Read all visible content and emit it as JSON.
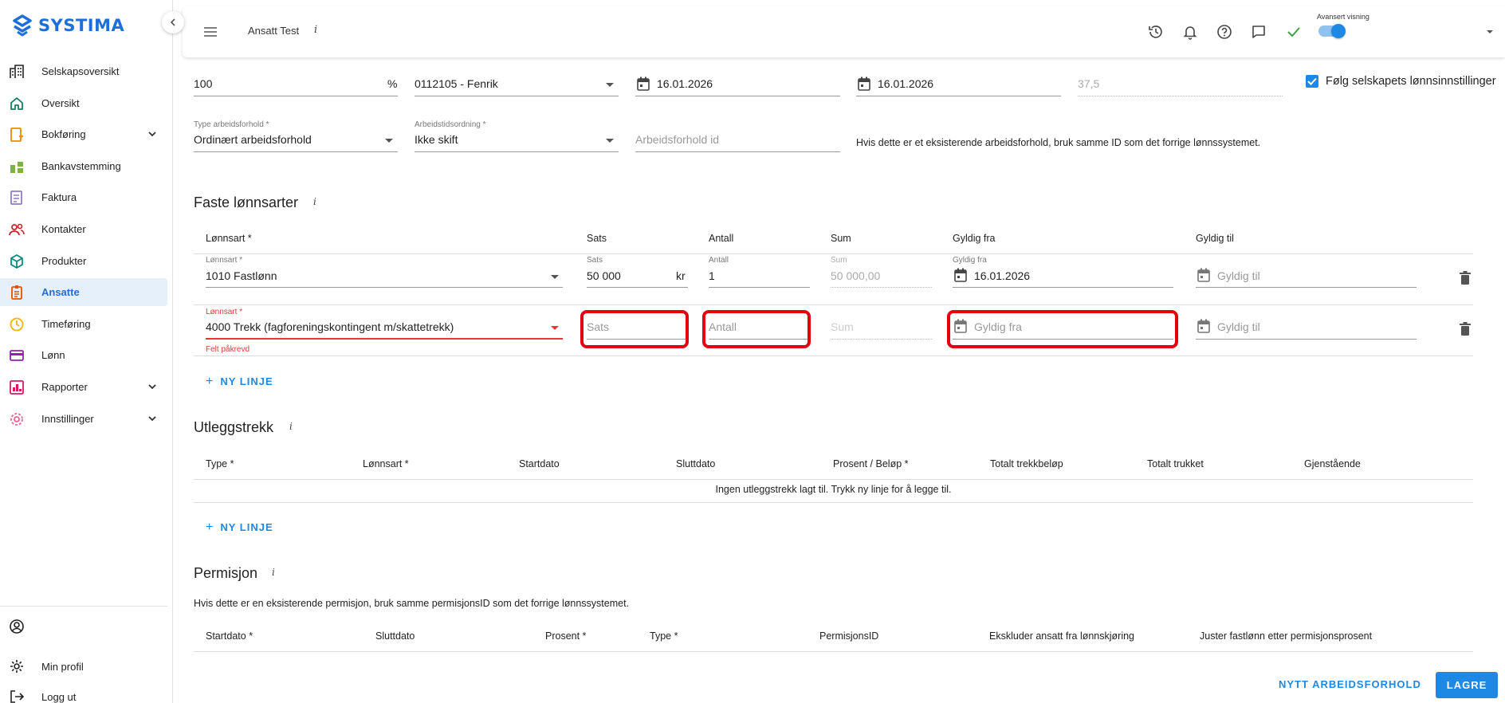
{
  "brand": {
    "name": "SYSTIMA",
    "color": "#1e6fd9"
  },
  "topbar": {
    "title": "Ansatt Test",
    "info": "i",
    "advanced_label": "Avansert visning",
    "icons": [
      "history-icon",
      "bell-icon",
      "help-icon",
      "chat-icon",
      "check-icon"
    ]
  },
  "sidebar": {
    "items": [
      {
        "label": "Selskapsoversikt",
        "icon": "buildings-icon"
      },
      {
        "label": "Oversikt",
        "icon": "home-icon"
      },
      {
        "label": "Bokføring",
        "icon": "bookkeeping-icon",
        "expandable": true
      },
      {
        "label": "Bankavstemming",
        "icon": "bank-icon"
      },
      {
        "label": "Faktura",
        "icon": "invoice-icon"
      },
      {
        "label": "Kontakter",
        "icon": "contacts-icon"
      },
      {
        "label": "Produkter",
        "icon": "product-icon"
      },
      {
        "label": "Ansatte",
        "icon": "employees-icon",
        "active": true
      },
      {
        "label": "Timeføring",
        "icon": "clock-icon"
      },
      {
        "label": "Lønn",
        "icon": "payroll-icon"
      },
      {
        "label": "Rapporter",
        "icon": "reports-icon",
        "expandable": true
      },
      {
        "label": "Innstillinger",
        "icon": "settings-icon",
        "expandable": true
      }
    ],
    "bottom": [
      {
        "label": "",
        "icon": "account-circle-icon"
      },
      {
        "label": "Min profil",
        "icon": "gear-icon"
      },
      {
        "label": "Logg ut",
        "icon": "logout-icon"
      }
    ]
  },
  "employment": {
    "row1": {
      "stilling_value": "100",
      "stilling_unit": "%",
      "yrke_value": "0112105 - Fenrik",
      "date1_value": "16.01.2026",
      "date2_value": "16.01.2026",
      "hours_value": "37,5",
      "follow_label": "Følg selskapets lønnsinnstillinger"
    },
    "row2": {
      "type_label": "Type arbeidsforhold *",
      "type_value": "Ordinært arbeidsforhold",
      "arbeidstid_label": "Arbeidstidsordning *",
      "arbeidstid_value": "Ikke skift",
      "id_placeholder": "Arbeidsforhold id",
      "id_hint": "Hvis dette er et eksisterende arbeidsforhold, bruk samme ID som det forrige lønnssystemet."
    }
  },
  "faste": {
    "title": "Faste lønnsarter",
    "info": "i",
    "headers": [
      "Lønnsart *",
      "Sats",
      "Antall",
      "Sum",
      "Gyldig fra",
      "Gyldig til"
    ],
    "row1": {
      "lonnsart_label": "Lønnsart *",
      "lonnsart_value": "1010 Fastlønn",
      "sats_label": "Sats",
      "sats_value": "50 000",
      "sats_unit": "kr",
      "antall_label": "Antall",
      "antall_value": "1",
      "sum_label": "Sum",
      "sum_value": "50 000,00",
      "fra_label": "Gyldig fra",
      "fra_value": "16.01.2026",
      "til_placeholder": "Gyldig til"
    },
    "row2": {
      "lonnsart_label": "Lønnsart *",
      "lonnsart_value": "4000 Trekk (fagforeningskontingent m/skattetrekk)",
      "error": "Felt påkrevd",
      "sats_placeholder": "Sats",
      "antall_placeholder": "Antall",
      "sum_placeholder": "Sum",
      "fra_placeholder": "Gyldig fra",
      "til_placeholder": "Gyldig til"
    },
    "add_label": "NY LINJE"
  },
  "utlegg": {
    "title": "Utleggstrekk",
    "info": "i",
    "headers": [
      "Type *",
      "Lønnsart *",
      "Startdato",
      "Sluttdato",
      "Prosent / Beløp *",
      "Totalt trekkbeløp",
      "Totalt trukket",
      "Gjenstående"
    ],
    "empty": "Ingen utleggstrekk lagt til. Trykk ny linje for å legge til.",
    "add_label": "NY LINJE"
  },
  "permisjon": {
    "title": "Permisjon",
    "info": "i",
    "hint": "Hvis dette er en eksisterende permisjon, bruk samme permisjonsID som det forrige lønnssystemet.",
    "headers": [
      "Startdato *",
      "Sluttdato",
      "Prosent *",
      "Type *",
      "PermisjonsID",
      "Ekskluder ansatt fra lønnskjøring",
      "Juster fastlønn etter permisjonsprosent"
    ]
  },
  "actions": {
    "new_employment": "NYTT ARBEIDSFORHOLD",
    "save": "LAGRE"
  }
}
